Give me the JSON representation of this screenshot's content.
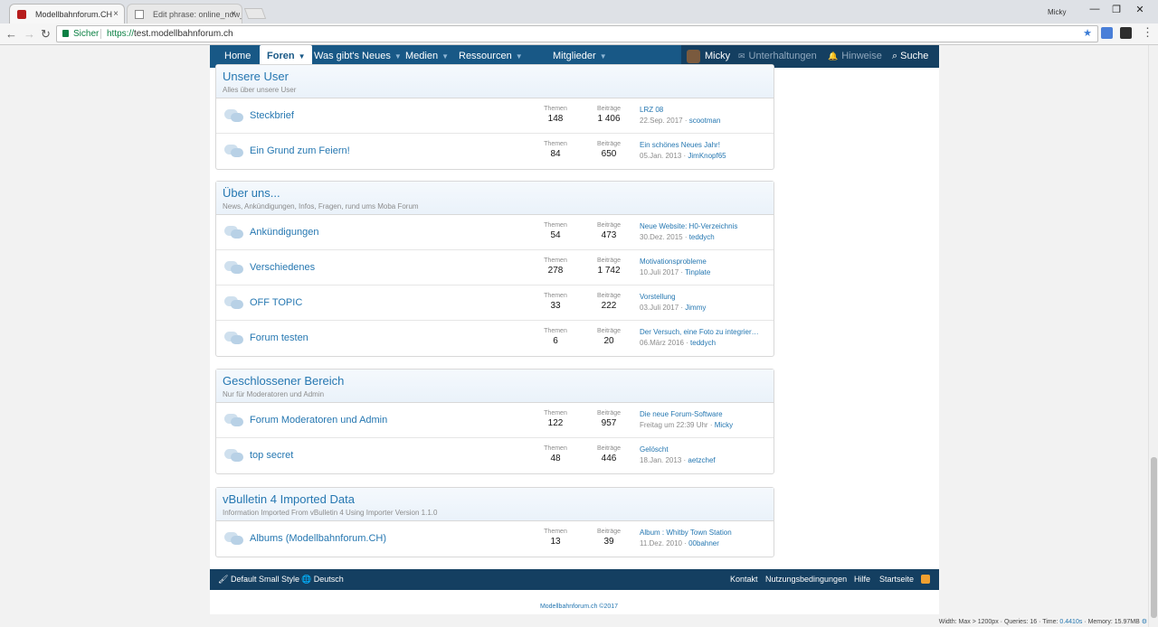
{
  "browser": {
    "tabs": [
      {
        "title": "Modellbahnforum.CH",
        "close": "×"
      },
      {
        "title": "Edit phrase: online_now_",
        "close": "×"
      }
    ],
    "profile": "Micky",
    "window_controls": [
      "—",
      "❐",
      "✕"
    ],
    "back": "←",
    "forward": "→",
    "reload": "↻",
    "secure_label": "Sicher",
    "url_scheme": "https://",
    "url_host": "test.modellbahnforum.ch",
    "star": "★"
  },
  "navbar": {
    "items": [
      "Home",
      "Foren",
      "Was gibt's Neues",
      "Medien",
      "Ressourcen",
      "Mitglieder"
    ],
    "caret": "▼",
    "user": "Micky",
    "conversations": "Unterhaltungen",
    "alerts": "Hinweise",
    "search": "Suche",
    "envelope": "✉",
    "bell": "🔔",
    "magnifier": "⌕"
  },
  "labels": {
    "themen": "Themen",
    "beitraege": "Beiträge"
  },
  "categories": [
    {
      "title": "Unsere User",
      "desc": "Alles über unsere User",
      "forums": [
        {
          "name": "Steckbrief",
          "themen": "148",
          "beitraege": "1 406",
          "last_title": "LRZ 08",
          "last_date": "22.Sep. 2017",
          "last_user": "scootman"
        },
        {
          "name": "Ein Grund zum Feiern!",
          "themen": "84",
          "beitraege": "650",
          "last_title": "Ein schönes Neues Jahr!",
          "last_date": "05.Jan. 2013",
          "last_user": "JimKnopf65"
        }
      ]
    },
    {
      "title": "Über uns...",
      "desc": "News, Ankündigungen, Infos, Fragen, rund ums Moba Forum",
      "forums": [
        {
          "name": "Ankündigungen",
          "themen": "54",
          "beitraege": "473",
          "last_title": "Neue Website: H0-Verzeichnis",
          "last_date": "30.Dez. 2015",
          "last_user": "teddych"
        },
        {
          "name": "Verschiedenes",
          "themen": "278",
          "beitraege": "1 742",
          "last_title": "Motivationsprobleme",
          "last_date": "10.Juli 2017",
          "last_user": "Tinplate"
        },
        {
          "name": "OFF TOPIC",
          "themen": "33",
          "beitraege": "222",
          "last_title": "Vorstellung",
          "last_date": "03.Juli 2017",
          "last_user": "Jimmy"
        },
        {
          "name": "Forum testen",
          "themen": "6",
          "beitraege": "20",
          "last_title": "Der Versuch, eine Foto zu integrier…",
          "last_date": "06.März 2016",
          "last_user": "teddych"
        }
      ]
    },
    {
      "title": "Geschlossener Bereich",
      "desc": "Nur für Moderatoren und Admin",
      "forums": [
        {
          "name": "Forum Moderatoren und Admin",
          "themen": "122",
          "beitraege": "957",
          "last_title": "Die neue Forum-Software",
          "last_date": "Freitag um 22:39 Uhr",
          "last_user": "Micky"
        },
        {
          "name": "top secret",
          "themen": "48",
          "beitraege": "446",
          "last_title": "Gelöscht",
          "last_date": "18.Jan. 2013",
          "last_user": "aetzchef"
        }
      ]
    },
    {
      "title": "vBulletin 4 Imported Data",
      "desc": "Information Imported From vBulletin 4 Using Importer Version 1.1.0",
      "forums": [
        {
          "name": "Albums (Modellbahnforum.CH)",
          "themen": "13",
          "beitraege": "39",
          "last_title": "Album : Whitby Town Station",
          "last_date": "11.Dez. 2010",
          "last_user": "00bahner"
        }
      ]
    }
  ],
  "footer": {
    "style": "Default Small Style",
    "language": "Deutsch",
    "links": [
      "Kontakt",
      "Nutzungsbedingungen",
      "Hilfe",
      "Startseite"
    ],
    "brush": "🖌",
    "globe": "🌐"
  },
  "copyright": "Modellbahnforum.ch ©2017",
  "debug": {
    "width": "Width: Max > 1200px",
    "queries": "Queries: 16",
    "time_label": "Time: ",
    "time_value": "0.4410s",
    "memory": "Memory: 15.97MB",
    "gear": "⚙"
  },
  "colors": {
    "nav": "#185886",
    "nav_dark": "#143f61",
    "link": "#2577b1"
  }
}
